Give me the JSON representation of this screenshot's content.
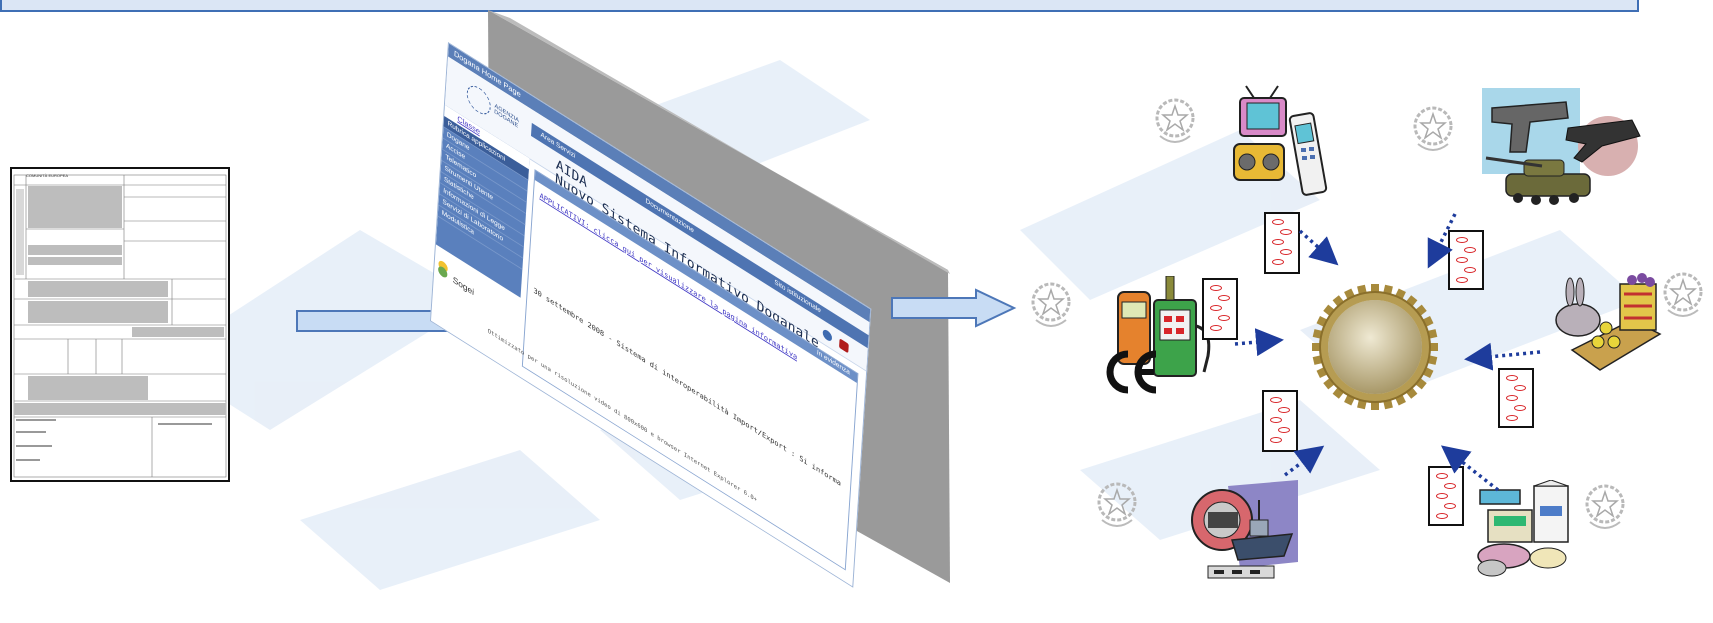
{
  "colors": {
    "accent_blue": "#3f6fb5",
    "arrow_fill": "#c8dcf4",
    "arrow_stroke": "#4d77b8",
    "dotted_arrow": "#1e3c9c",
    "pill_red": "#d8262a",
    "gear": "#b6a26a",
    "watermark": "#e6eef8"
  },
  "form": {
    "title": "COMUNITÀ EUROPEA"
  },
  "aida": {
    "window_title": "Dogana Home Page",
    "header": {
      "logo_line1": "AGENZIA",
      "logo_line2": "DOGANE",
      "title_line1": "AIDA",
      "title_line2": "Nuovo Sistema Informativo Doganale"
    },
    "tabs": [
      "Area Servizi",
      "Documentazione",
      "Sito istituzionale"
    ],
    "sidebar": {
      "first_link": "Classe",
      "items": [
        "Rubrica applicazioni",
        "Dogane",
        "Accise",
        "Telematico",
        "Strumenti Utente",
        "Statistiche",
        "Informazioni di Legge",
        "Servizi di Laboratorio",
        "Modulistica"
      ]
    },
    "panel": {
      "header": "In evidenza",
      "link": "APPLICATIVI: clicca qui per visualizzare la pagina informativa",
      "news": "30 settembre 2008 - Sistema di interoperabilità Import/Export : Si informa"
    },
    "sogei": "Sogei",
    "footer": "Ottimizzato per una risoluzione video di 800x600 e browser Internet Explorer 6.0+"
  },
  "icons": [
    "electronics-clipart",
    "weapons-clipart",
    "fuel-pump-clipart",
    "ce-mark-icon",
    "gear-icon",
    "animals-clipart",
    "ship-clipart",
    "food-products-clipart",
    "republic-emblem-icon"
  ]
}
